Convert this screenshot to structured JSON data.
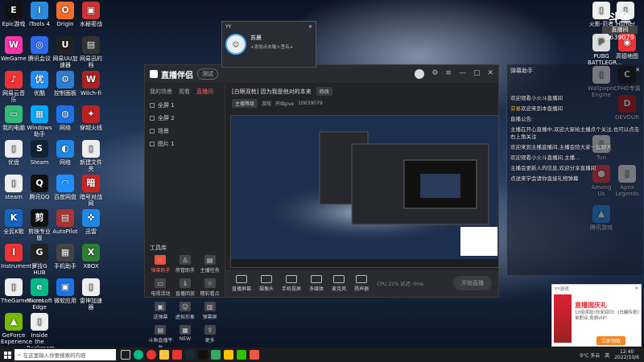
{
  "desktop_icons_left": [
    {
      "label": "Epic游戏",
      "color": "#111",
      "glyph": "E"
    },
    {
      "label": "iTools 4",
      "color": "#2a8be0",
      "glyph": "i"
    },
    {
      "label": "Origin",
      "color": "#f56c2d",
      "glyph": "O"
    },
    {
      "label": "水秘密战",
      "color": "#c33",
      "glyph": "▣"
    },
    {
      "label": "WeGame",
      "color": "#f3a",
      "glyph": "W"
    },
    {
      "label": "腾讯会议",
      "color": "#2d6cf0",
      "glyph": "◎"
    },
    {
      "label": "网易UU加速器",
      "color": "#222",
      "glyph": "U"
    },
    {
      "label": "网易迅的档",
      "color": "#333",
      "glyph": "▤"
    },
    {
      "label": "网易云音乐",
      "color": "#e33",
      "glyph": "♪"
    },
    {
      "label": "优酷",
      "color": "#1e90ff",
      "glyph": "优"
    },
    {
      "label": "控制面板",
      "color": "#2d7dd2",
      "glyph": "⚙"
    },
    {
      "label": "Wilch-fi",
      "color": "#a22",
      "glyph": "W"
    },
    {
      "label": "我的电脑",
      "color": "#3b7",
      "glyph": "▭"
    },
    {
      "label": "Windows助手",
      "color": "#0af",
      "glyph": "▦"
    },
    {
      "label": "网络",
      "color": "#1a73e8",
      "glyph": "◍"
    },
    {
      "label": "穿越火线",
      "color": "#b22",
      "glyph": "✦"
    },
    {
      "label": "优盘",
      "color": "#eee",
      "glyph": "▯"
    },
    {
      "label": "Steam",
      "color": "#123",
      "glyph": "S"
    },
    {
      "label": "网络",
      "color": "#1e88e5",
      "glyph": "◐"
    },
    {
      "label": "新建文件夹",
      "color": "#eee",
      "glyph": "▯"
    },
    {
      "label": "steam",
      "color": "#eee",
      "glyph": "▯"
    },
    {
      "label": "腾讯QQ",
      "color": "#111",
      "glyph": "Q"
    },
    {
      "label": "百度网盘",
      "color": "#1e90ff",
      "glyph": "◠"
    },
    {
      "label": "暗号对战网",
      "color": "#c22",
      "glyph": "暗"
    },
    {
      "label": "全民K歌",
      "color": "#1565c0",
      "glyph": "K"
    },
    {
      "label": "剪映专业版",
      "color": "#111",
      "glyph": "剪"
    },
    {
      "label": "AutoPilot",
      "color": "#a33",
      "glyph": "▤"
    },
    {
      "label": "迅雷",
      "color": "#1e88e5",
      "glyph": "✜"
    },
    {
      "label": "Instrumental",
      "color": "#e33",
      "glyph": "I"
    },
    {
      "label": "罗技G HUB",
      "color": "#222",
      "glyph": "G"
    },
    {
      "label": "手机助手",
      "color": "#444",
      "glyph": "▦"
    },
    {
      "label": "XBOX",
      "color": "#2e7d32",
      "glyph": "X"
    },
    {
      "label": "TheGameExcel",
      "color": "#eee",
      "glyph": "▯"
    },
    {
      "label": "Microsoft Edge",
      "color": "#0b8",
      "glyph": "e"
    },
    {
      "label": "微软应用",
      "color": "#1a73e8",
      "glyph": "▣"
    },
    {
      "label": "雷神加速器",
      "color": "#eee",
      "glyph": "▯"
    },
    {
      "label": "GeForce Experience",
      "color": "#76b900",
      "glyph": "▲"
    },
    {
      "label": "Inside the Backroom",
      "color": "#eee",
      "glyph": "▯"
    }
  ],
  "desktop_icons_right": [
    {
      "label": "火影-忍者",
      "color": "#eee",
      "glyph": "▯"
    },
    {
      "label": "Humer",
      "color": "#eee",
      "glyph": "▯"
    },
    {
      "label": "PUBG BATTLEGR...",
      "color": "#ddd",
      "glyph": "P"
    },
    {
      "label": "高德地图",
      "color": "#e33",
      "glyph": "◉"
    },
    {
      "label": "Wallpaper Engine",
      "color": "#eee",
      "glyph": "▯"
    },
    {
      "label": "CFHD专属",
      "color": "#111",
      "glyph": "C"
    },
    {
      "label": "DEVOUR",
      "color": "#b11",
      "glyph": "D"
    },
    {
      "label": "Tun",
      "color": "#eee",
      "glyph": "▯"
    },
    {
      "label": "Among Us",
      "color": "#e33",
      "glyph": "●"
    },
    {
      "label": "Apex Legends",
      "color": "#eee",
      "glyph": "▯"
    },
    {
      "label": "腾讯游戏",
      "color": "#1e88e5",
      "glyph": "▲"
    }
  ],
  "watermark": {
    "line1": "斗鱼",
    "line2": "直播间",
    "line3": "0639079"
  },
  "obs": {
    "app_title": "直播伴侣",
    "version_tag": "测试",
    "left_tabs": [
      "我的场景",
      "观看",
      "直播间"
    ],
    "scenes": [
      "全屏 1",
      "全屏 2",
      "场景",
      "图片 1"
    ],
    "tools_title": "工具库",
    "tools": [
      {
        "label": "弹幕助手",
        "glyph": "✉",
        "hot": true
      },
      {
        "label": "房管助手",
        "glyph": "♙",
        "hot": false
      },
      {
        "label": "主播任务",
        "glyph": "▤",
        "hot": false
      },
      {
        "label": "电视活动",
        "glyph": "▭",
        "hot": false
      },
      {
        "label": "直播回放",
        "glyph": "⇓",
        "hot": false
      },
      {
        "label": "精彩看点",
        "glyph": "☆",
        "hot": false
      },
      {
        "label": "送弹幕",
        "glyph": "▣",
        "hot": false
      },
      {
        "label": "虚拟形象",
        "glyph": "☺",
        "hot": false
      },
      {
        "label": "弹幕屏",
        "glyph": "▥",
        "hot": false
      },
      {
        "label": "斗鱼直播平台",
        "glyph": "▤",
        "hot": false
      },
      {
        "label": "NEW",
        "glyph": "▦",
        "hot": false
      },
      {
        "label": "更多",
        "glyph": "⇪",
        "hot": false
      }
    ],
    "room_title": "[白眼双枪] 因为我是他对的本来",
    "room_btn": "修改",
    "sub_labels": [
      "主播等级",
      "游戏",
      "开始pve",
      "10639079"
    ],
    "bottom_items": [
      "直播屏幕",
      "摄像头",
      "手机投屏",
      "多媒体",
      "麦克风",
      "扬声器"
    ],
    "start_label": "开始直播",
    "stats": "CPU 21%   延迟: 0ms"
  },
  "yy_popup": {
    "title": "YY",
    "name": "苏晨",
    "signature": "+添加点击输入签名+"
  },
  "chat": {
    "header": "弹幕助手",
    "lines": [
      {
        "sys": "",
        "text": "欢迎观看小火斗直播间"
      },
      {
        "sys": "",
        "text": "欢迎来到本直播间",
        "user": "芬易"
      },
      {
        "sys": "",
        "text": "直播公告:"
      },
      {
        "sys": "",
        "text": "主播在开心直播中,欢迎大家给主播点个关注,也可以点击右上角关注"
      },
      {
        "sys": "",
        "text": "欢迎来到主播直播间,主播会陪大家一起聊天"
      },
      {
        "sys": "",
        "text": "欢迎观看小火斗直播间,主播..."
      },
      {
        "sys": "",
        "text": "主播会更新人的信息,欢迎分享直播间"
      },
      {
        "sys": "",
        "text": "点送来学会请你直接礼物弹幕"
      }
    ]
  },
  "notification": {
    "app": "YY游戏",
    "title": "直播国庆礼",
    "text": "10倍奖励!你来回归!《白糖传奇》单职业,免费VIP!",
    "button": "立即领取"
  },
  "taskbar": {
    "search_placeholder": "在这里输入你要搜索的内容",
    "weather": "9°C 多云",
    "lang": "英",
    "time": "12:40",
    "date": "2022/10/6"
  },
  "colors": {
    "accent_red": "#ff5a5a",
    "notif_orange": "#f5841f"
  }
}
